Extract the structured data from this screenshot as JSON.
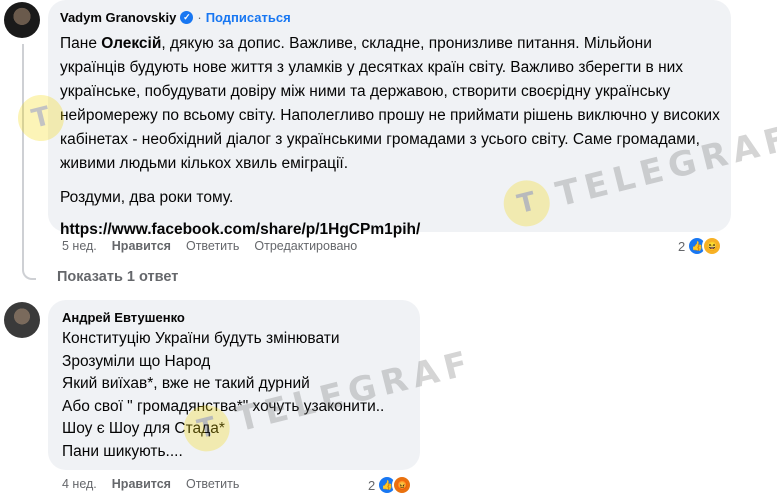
{
  "comment1": {
    "author": "Vadym Granovskiy",
    "dot": "·",
    "subscribe_label": "Подписаться",
    "text_intro": "Пане ",
    "text_name": "Олексій",
    "text_body": ", дякую за допис. Важливе, складне, пронизливе питання. Мільйони українців будують нове життя з уламків у десятках країн світу. Важливо зберегти в них українське, побудувати довіру між ними та державою, створити своєрідну українську нейромережу по всьому світу. Наполегливо прошу не приймати рішень виключно у високих кабінетах - необхідний діалог з українськими громадами з усього світу. Саме громадами, живими людьми кількох хвиль еміграції.",
    "text_para2": "Роздуми, два роки тому.",
    "link": "https://www.facebook.com/share/p/1HgCPm1pih/",
    "time": "5 нед.",
    "like_label": "Нравится",
    "reply_label": "Ответить",
    "status": "Отредактировано",
    "reaction_count": "2"
  },
  "show_replies_label": "Показать 1 ответ",
  "comment2": {
    "author": "Андрей Евтушенко",
    "lines": [
      "Конституцію України будуть змінювати",
      "Зрозуміли що Народ",
      "Який виїхав*, вже не такий дурний",
      "Або свої \" громадянства*\" хочуть узаконити..",
      "Шоу є Шоу для Стада*",
      "Пани шикують...."
    ],
    "time": "4 нед.",
    "like_label": "Нравится",
    "reply_label": "Ответить",
    "reaction_count": "2"
  },
  "watermark": {
    "brand_text": "TELEGRAF",
    "logo_letter": "T",
    "logo_color": "#f5d800"
  }
}
